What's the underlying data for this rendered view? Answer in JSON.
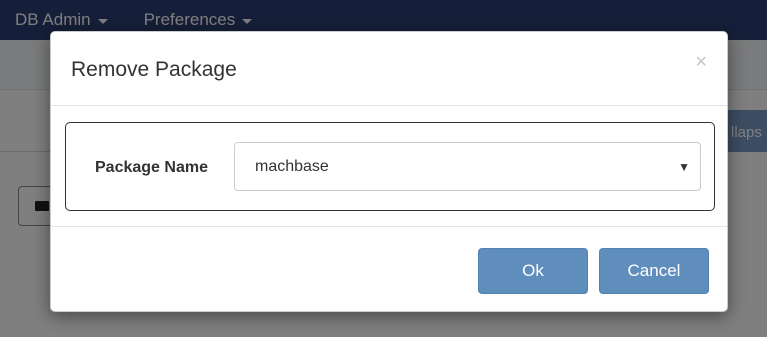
{
  "navbar": {
    "menus": [
      {
        "label": "DB Admin"
      },
      {
        "label": "Preferences"
      }
    ]
  },
  "background": {
    "collapse_button_label": "llaps"
  },
  "modal": {
    "title": "Remove Package",
    "close_symbol": "×",
    "field_label": "Package Name",
    "select": {
      "selected_value": "machbase",
      "arrow_symbol": "▼"
    },
    "ok_label": "Ok",
    "cancel_label": "Cancel"
  },
  "colors": {
    "navbar": "#2c3f73",
    "primary_button": "#5f8ebd",
    "backdrop": "rgba(0,0,0,0.5)"
  }
}
